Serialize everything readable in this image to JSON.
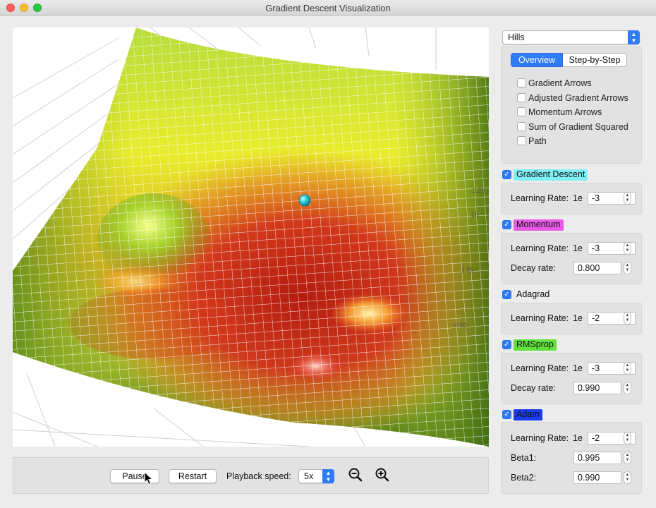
{
  "window": {
    "title": "Gradient Descent Visualization"
  },
  "plot": {
    "axis_tick_labels": [
      "2.25",
      "15",
      "1.25",
      "0.40"
    ]
  },
  "controls": {
    "pause_label": "Pause",
    "restart_label": "Restart",
    "playback_label": "Playback speed:",
    "playback_value": "5x"
  },
  "sidebar": {
    "surface_select": "Hills",
    "tabs": [
      {
        "label": "Overview",
        "selected": true
      },
      {
        "label": "Step-by-Step",
        "selected": false
      }
    ],
    "options": [
      {
        "label": "Gradient Arrows",
        "checked": false
      },
      {
        "label": "Adjusted Gradient Arrows",
        "checked": false
      },
      {
        "label": "Momentum Arrows",
        "checked": false
      },
      {
        "label": "Sum of Gradient Squared",
        "checked": false
      },
      {
        "label": "Path",
        "checked": false
      }
    ],
    "algorithms": [
      {
        "name": "Gradient Descent",
        "checked": true,
        "color": "#7ff0f4",
        "params": [
          {
            "label": "Learning Rate:",
            "prefix": "1e",
            "value": "-3"
          }
        ]
      },
      {
        "name": "Momentum",
        "checked": true,
        "color": "#e85ae6",
        "params": [
          {
            "label": "Learning Rate:",
            "prefix": "1e",
            "value": "-3"
          },
          {
            "label": "Decay rate:",
            "prefix": "",
            "value": "0.800"
          }
        ]
      },
      {
        "name": "Adagrad",
        "checked": true,
        "color": "#ffffff",
        "params": [
          {
            "label": "Learning Rate:",
            "prefix": "1e",
            "value": "-2"
          }
        ]
      },
      {
        "name": "RMSprop",
        "checked": true,
        "color": "#5fe23a",
        "params": [
          {
            "label": "Learning Rate:",
            "prefix": "1e",
            "value": "-3"
          },
          {
            "label": "Decay rate:",
            "prefix": "",
            "value": "0.990"
          }
        ]
      },
      {
        "name": "Adam",
        "checked": true,
        "color": "#1b3cf0",
        "params": [
          {
            "label": "Learning Rate:",
            "prefix": "1e",
            "value": "-2"
          },
          {
            "label": "Beta1:",
            "prefix": "",
            "value": "0.995"
          },
          {
            "label": "Beta2:",
            "prefix": "",
            "value": "0.990"
          }
        ]
      }
    ]
  }
}
